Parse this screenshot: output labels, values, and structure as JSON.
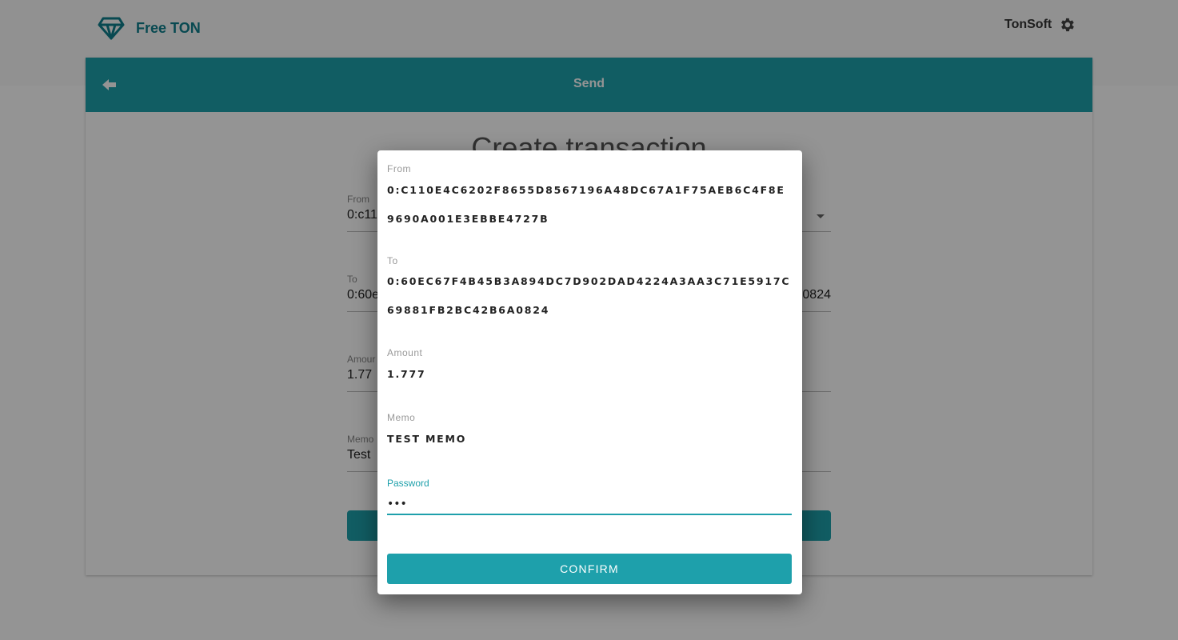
{
  "app": {
    "brand_name": "Free TON",
    "account_name": "TonSoft"
  },
  "header": {
    "title": "Send"
  },
  "form": {
    "title": "Create transaction",
    "from_label": "From",
    "from_value": "0:c11",
    "to_label": "To",
    "to_value": "0:60e",
    "to_value_tail": "0824",
    "amount_label": "Amour",
    "amount_value": "1.77",
    "memo_label": "Memo",
    "memo_value": "Test"
  },
  "dialog": {
    "from_label": "From",
    "from_value": "0:C110E4C6202F8655D8567196A48DC67A1F75AEB6C4F8E9690A001E3EBBE4727B",
    "to_label": "To",
    "to_value": "0:60EC67F4B45B3A894DC7D902DAD4224A3AA3C71E5917C69881FB2BC42B6A0824",
    "amount_label": "Amount",
    "amount_value": "1.777",
    "memo_label": "Memo",
    "memo_value": "TEST MEMO",
    "password_label": "Password",
    "password_value": "•••",
    "confirm_label": "CONFIRM"
  },
  "colors": {
    "accent": "#1ea0ab",
    "brand": "#0f7f8c"
  },
  "icons": {
    "brand": "diamond-icon",
    "settings": "gear-icon",
    "back": "arrow-left-icon"
  }
}
